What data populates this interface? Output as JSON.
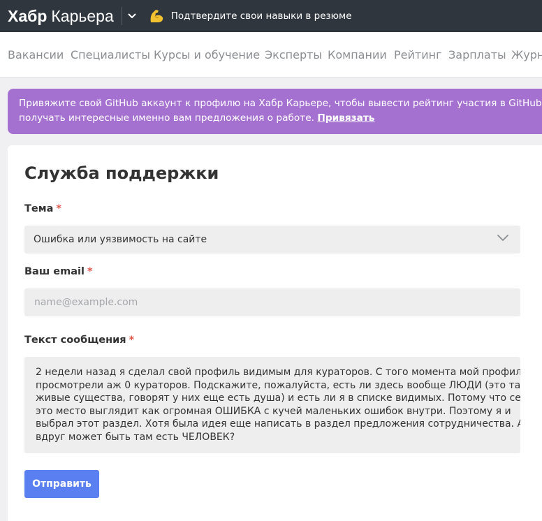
{
  "header": {
    "brand": "Хабр",
    "product": "Карьера",
    "promo_text": "Подтвердите свои навыки в резюме",
    "promo_icon": "flexed-biceps-icon",
    "colors": {
      "background": "#2f363d"
    }
  },
  "nav": {
    "items": [
      {
        "label": "Вакансии"
      },
      {
        "label": "Специалисты"
      },
      {
        "label": "Курсы и обучение"
      },
      {
        "label": "Эксперты"
      },
      {
        "label": "Компании"
      },
      {
        "label": "Рейтинг"
      },
      {
        "label": "Зарплаты"
      },
      {
        "label": "Журн"
      }
    ]
  },
  "banner": {
    "line1": "Привяжите свой GitHub аккаунт к профилю на Хабр Карьере, чтобы вывести рейтинг участия в GitHub. Бла",
    "line2": "получать интересные именно вам предложения о работе.",
    "link": "Привязать",
    "color": "#a571d0"
  },
  "form": {
    "title": "Служба поддержки",
    "required_mark": "*",
    "topic": {
      "label": "Тема",
      "value": "Ошибка или уязвимость на сайте"
    },
    "email": {
      "label": "Ваш email",
      "value": "",
      "placeholder": "name@example.com"
    },
    "message": {
      "label": "Текст сообщения",
      "lines": [
        "2 недели назад я сделал свой профиль видимым для кураторов. С того момента мой профиль",
        "просмотрели аж 0 кураторов. Подскажите, пожалуйста, есть ли здесь вообще ЛЮДИ (это такие",
        "живые существа, говорят у них еще есть душа) и есть ли я в списке видимых. Потому что сейчас",
        "это место выглядит как огромная ОШИБКА с кучей маленьких ошибок внутри. Поэтому я и",
        "выбрал этот раздел. Хотя была идея еще написать в раздел предложения сотрудничества. А",
        "вдруг может быть там есть ЧЕЛОВЕК?"
      ]
    },
    "submit_label": "Отправить",
    "accent_color": "#5a7ff0"
  }
}
